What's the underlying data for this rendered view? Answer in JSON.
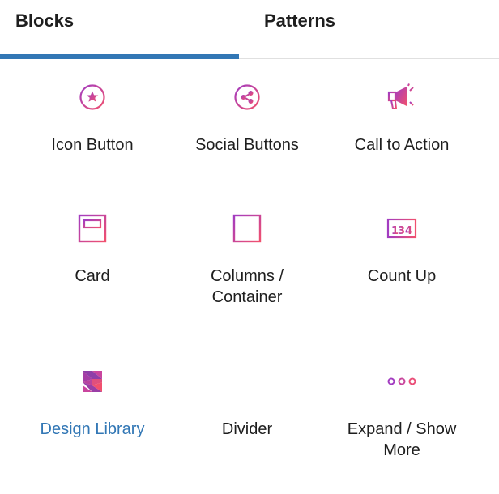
{
  "tabs": {
    "blocks_label": "Blocks",
    "patterns_label": "Patterns",
    "active": "Blocks"
  },
  "colors": {
    "accent": "#3277b5",
    "icon_gradient_start": "#b63bb0",
    "icon_gradient_end": "#f1506e"
  },
  "blocks": [
    {
      "label": "Icon Button",
      "icon": "star-circle-icon"
    },
    {
      "label": "Social Buttons",
      "icon": "share-icon"
    },
    {
      "label": "Call to Action",
      "icon": "megaphone-icon"
    },
    {
      "label": "Card",
      "icon": "card-icon"
    },
    {
      "label": "Columns / Container",
      "icon": "columns-icon"
    },
    {
      "label": "Count Up",
      "icon": "counter-icon"
    },
    {
      "label": "Design Library",
      "icon": "stackable-logo-icon"
    },
    {
      "label": "Divider",
      "icon": "divider-icon"
    },
    {
      "label": "Expand / Show More",
      "icon": "more-dots-icon"
    }
  ]
}
